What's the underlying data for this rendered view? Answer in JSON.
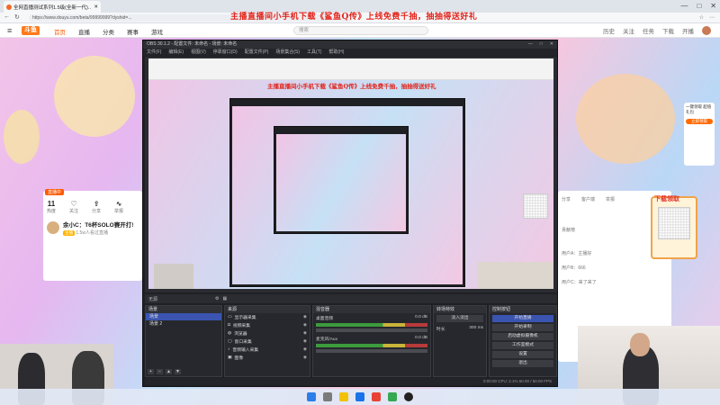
{
  "browser": {
    "tab_title": "全网直播测试系列1.5级(全新一代)…",
    "url": "https://www.douyu.com/beta/99999999?dyshid=...",
    "window_controls": [
      "—",
      "□",
      "✕"
    ]
  },
  "site": {
    "logo": "斗鱼",
    "nav": [
      "首页",
      "直播",
      "分类",
      "赛事",
      "游戏"
    ],
    "search_placeholder": "搜索",
    "user_links": [
      "历史",
      "关注",
      "任务",
      "下载",
      "开播"
    ]
  },
  "announcement": "主播直播间小手机下载《鲨鱼Q传》上线免费千抽，抽抽得送好礼",
  "streamer_panel": {
    "tag": "直播中",
    "stats": [
      {
        "value": "11",
        "label": "热度"
      },
      {
        "value": "",
        "label": "关注"
      },
      {
        "value": "",
        "label": "分享"
      },
      {
        "value": "",
        "label": "举报"
      }
    ],
    "name": "余小C：T6杯SOLO赛开打!",
    "badge": "主播",
    "sub": "1.5w人看过直播"
  },
  "right_panel": {
    "icons": [
      "分享",
      "客户端",
      "举报"
    ],
    "chat": [
      "贡献榜",
      "用户A：主播好",
      "用户B：666",
      "用户C：来了来了"
    ]
  },
  "gift": {
    "label": "下载领取"
  },
  "promo": {
    "text": "一键领取 超值礼包",
    "btn": "立即领取"
  },
  "obs": {
    "title": "OBS 30.1.2 - 配置文件: 未命名 - 场景: 未命名",
    "menu": [
      "文件(F)",
      "编辑(E)",
      "视图(V)",
      "停靠窗口(D)",
      "配置文件(P)",
      "场景集合(S)",
      "工具(T)",
      "帮助(H)"
    ],
    "preview_announcement": "主播直播间小手机下载《鲨鱼Q传》上线免费千抽，抽抽得送好礼",
    "dockbar_label": "无源",
    "scenes": {
      "title": "场景",
      "items": [
        "场景",
        "场景 2"
      ]
    },
    "sources": {
      "title": "来源",
      "items": [
        "显示器采集",
        "视频采集",
        "浏览器",
        "窗口采集",
        "音频输入采集",
        "图像"
      ]
    },
    "mixer": {
      "title": "混音器",
      "rows": [
        {
          "name": "桌面音频",
          "db": "0.0 dB"
        },
        {
          "name": "麦克风/Aux",
          "db": "0.0 dB"
        }
      ]
    },
    "transitions": {
      "title": "转场特效",
      "type": "淡入淡出",
      "duration_label": "时长",
      "duration": "300 ms"
    },
    "controls": {
      "title": "控制按钮",
      "buttons": [
        "开始直播",
        "开始录制",
        "启动虚拟摄像机",
        "工作室模式",
        "设置",
        "退出"
      ]
    },
    "status": "0:00:00   CPU: 2.1%   60.00 / 60.00 FPS"
  },
  "colors": {
    "obs_bg": "#1f2024",
    "obs_accent": "#3a54b0",
    "brand": "#ff7a1a",
    "announcement": "#e2231a"
  }
}
